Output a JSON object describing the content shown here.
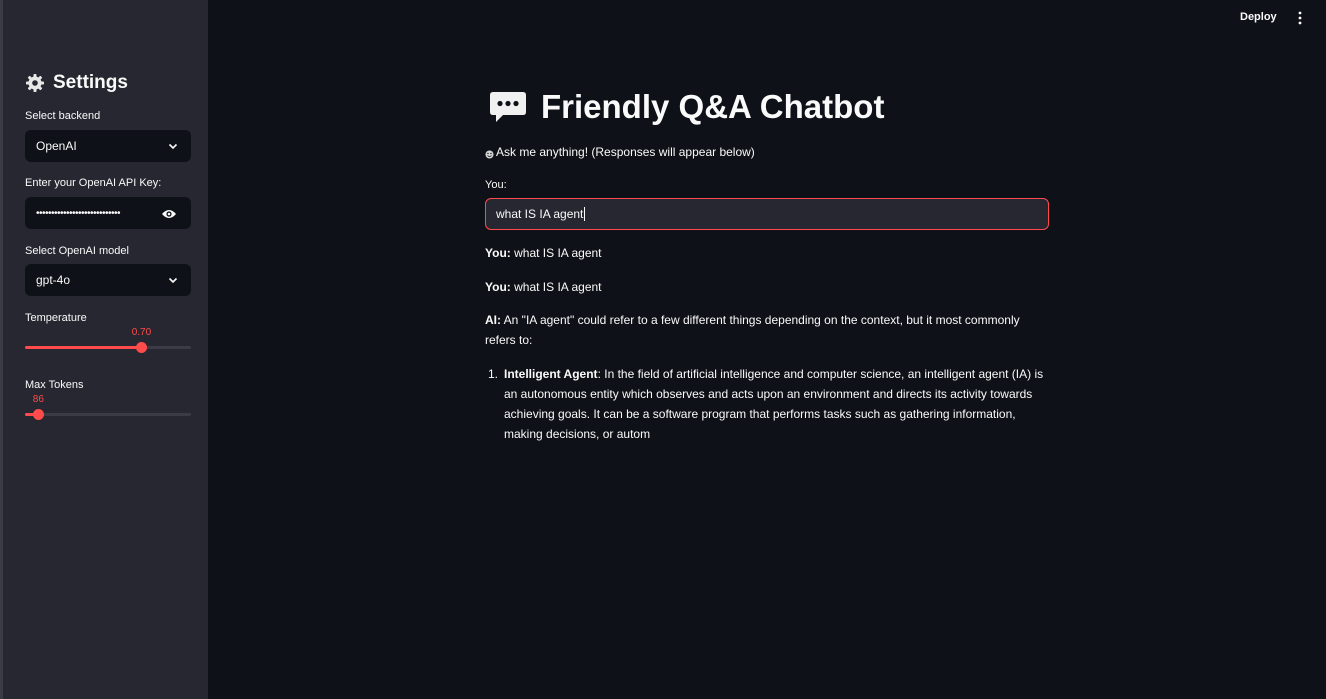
{
  "sidebar": {
    "title": "Settings",
    "backend_label": "Select backend",
    "backend_value": "OpenAI",
    "api_key_label": "Enter your OpenAI API Key:",
    "api_key_masked": "••••••••••••••••••••••••••••",
    "model_label": "Select OpenAI model",
    "model_value": "gpt-4o",
    "temperature_label": "Temperature",
    "temperature_value": "0.70",
    "temperature_fraction": 0.7,
    "max_tokens_label": "Max Tokens",
    "max_tokens_value": "86",
    "max_tokens_fraction": 0.08
  },
  "header": {
    "deploy_label": "Deploy"
  },
  "main": {
    "title": "Friendly Q&A Chatbot",
    "subtitle": "Ask me anything! (Responses will appear below)",
    "input_label": "You:",
    "input_value": "what IS IA agent",
    "messages": [
      {
        "speaker": "You:",
        "text": " what IS IA agent"
      },
      {
        "speaker": "You:",
        "text": " what IS IA agent"
      },
      {
        "speaker": "AI:",
        "text": " An \"IA agent\" could refer to a few different things depending on the context, but it most commonly refers to:"
      }
    ],
    "list_item": {
      "number": "1.",
      "term": "Intelligent Agent",
      "text": ": In the field of artificial intelligence and computer science, an intelligent agent (IA) is an autonomous entity which observes and acts upon an environment and directs its activity towards achieving goals. It can be a software program that performs tasks such as gathering information, making decisions, or autom"
    }
  },
  "colors": {
    "accent": "#ff4b4b",
    "background": "#0e1117",
    "sidebar": "#262730"
  }
}
